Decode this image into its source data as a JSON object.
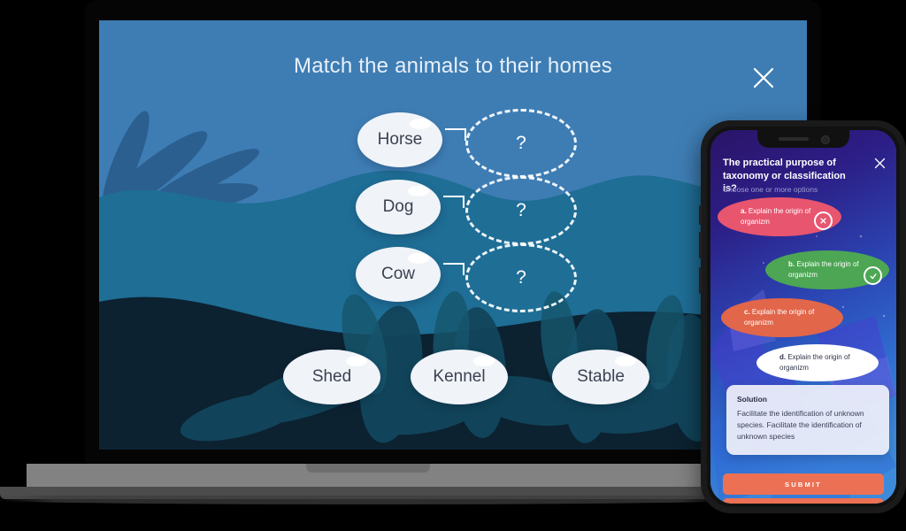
{
  "laptop": {
    "title": "Match the animals to their homes",
    "close_icon": "close-icon",
    "animals": [
      {
        "label": "Horse"
      },
      {
        "label": "Dog"
      },
      {
        "label": "Cow"
      }
    ],
    "drop_targets": [
      {
        "label": "?"
      },
      {
        "label": "?"
      },
      {
        "label": "?"
      }
    ],
    "homes": [
      {
        "label": "Shed"
      },
      {
        "label": "Kennel"
      },
      {
        "label": "Stable"
      }
    ],
    "colors": {
      "sky": "#3E7DB4",
      "hill_mid": "#1F6E96",
      "foliage_dark": "#0C2231",
      "pill_bg": "#F0F3F8",
      "pill_text": "#3B4252"
    }
  },
  "phone": {
    "question": "The practical purpose of taxonomy or classification is?",
    "subtitle": "Choose one or more options",
    "close_icon": "close-icon",
    "options": [
      {
        "key": "a.",
        "text": "Explain the origin of organizm",
        "state": "incorrect",
        "color": "#E8556F",
        "badge": "cross-icon"
      },
      {
        "key": "b.",
        "text": "Explain the origin of organizm",
        "state": "correct",
        "color": "#4CA654",
        "badge": "check-icon"
      },
      {
        "key": "c.",
        "text": "Explain the origin of organizm",
        "state": "neutral",
        "color": "#E2664A",
        "badge": ""
      },
      {
        "key": "d.",
        "text": "Explain the origin of organizm",
        "state": "neutral",
        "color": "#FFFFFF",
        "badge": ""
      }
    ],
    "solution": {
      "title": "Solution",
      "body": "Facilitate the identification of unknown species. Facilitate the identification of unknown species"
    },
    "submit_label": "SUBMIT",
    "colors": {
      "submit": "#EC7154",
      "subtitle": "#9D9BD2"
    }
  }
}
